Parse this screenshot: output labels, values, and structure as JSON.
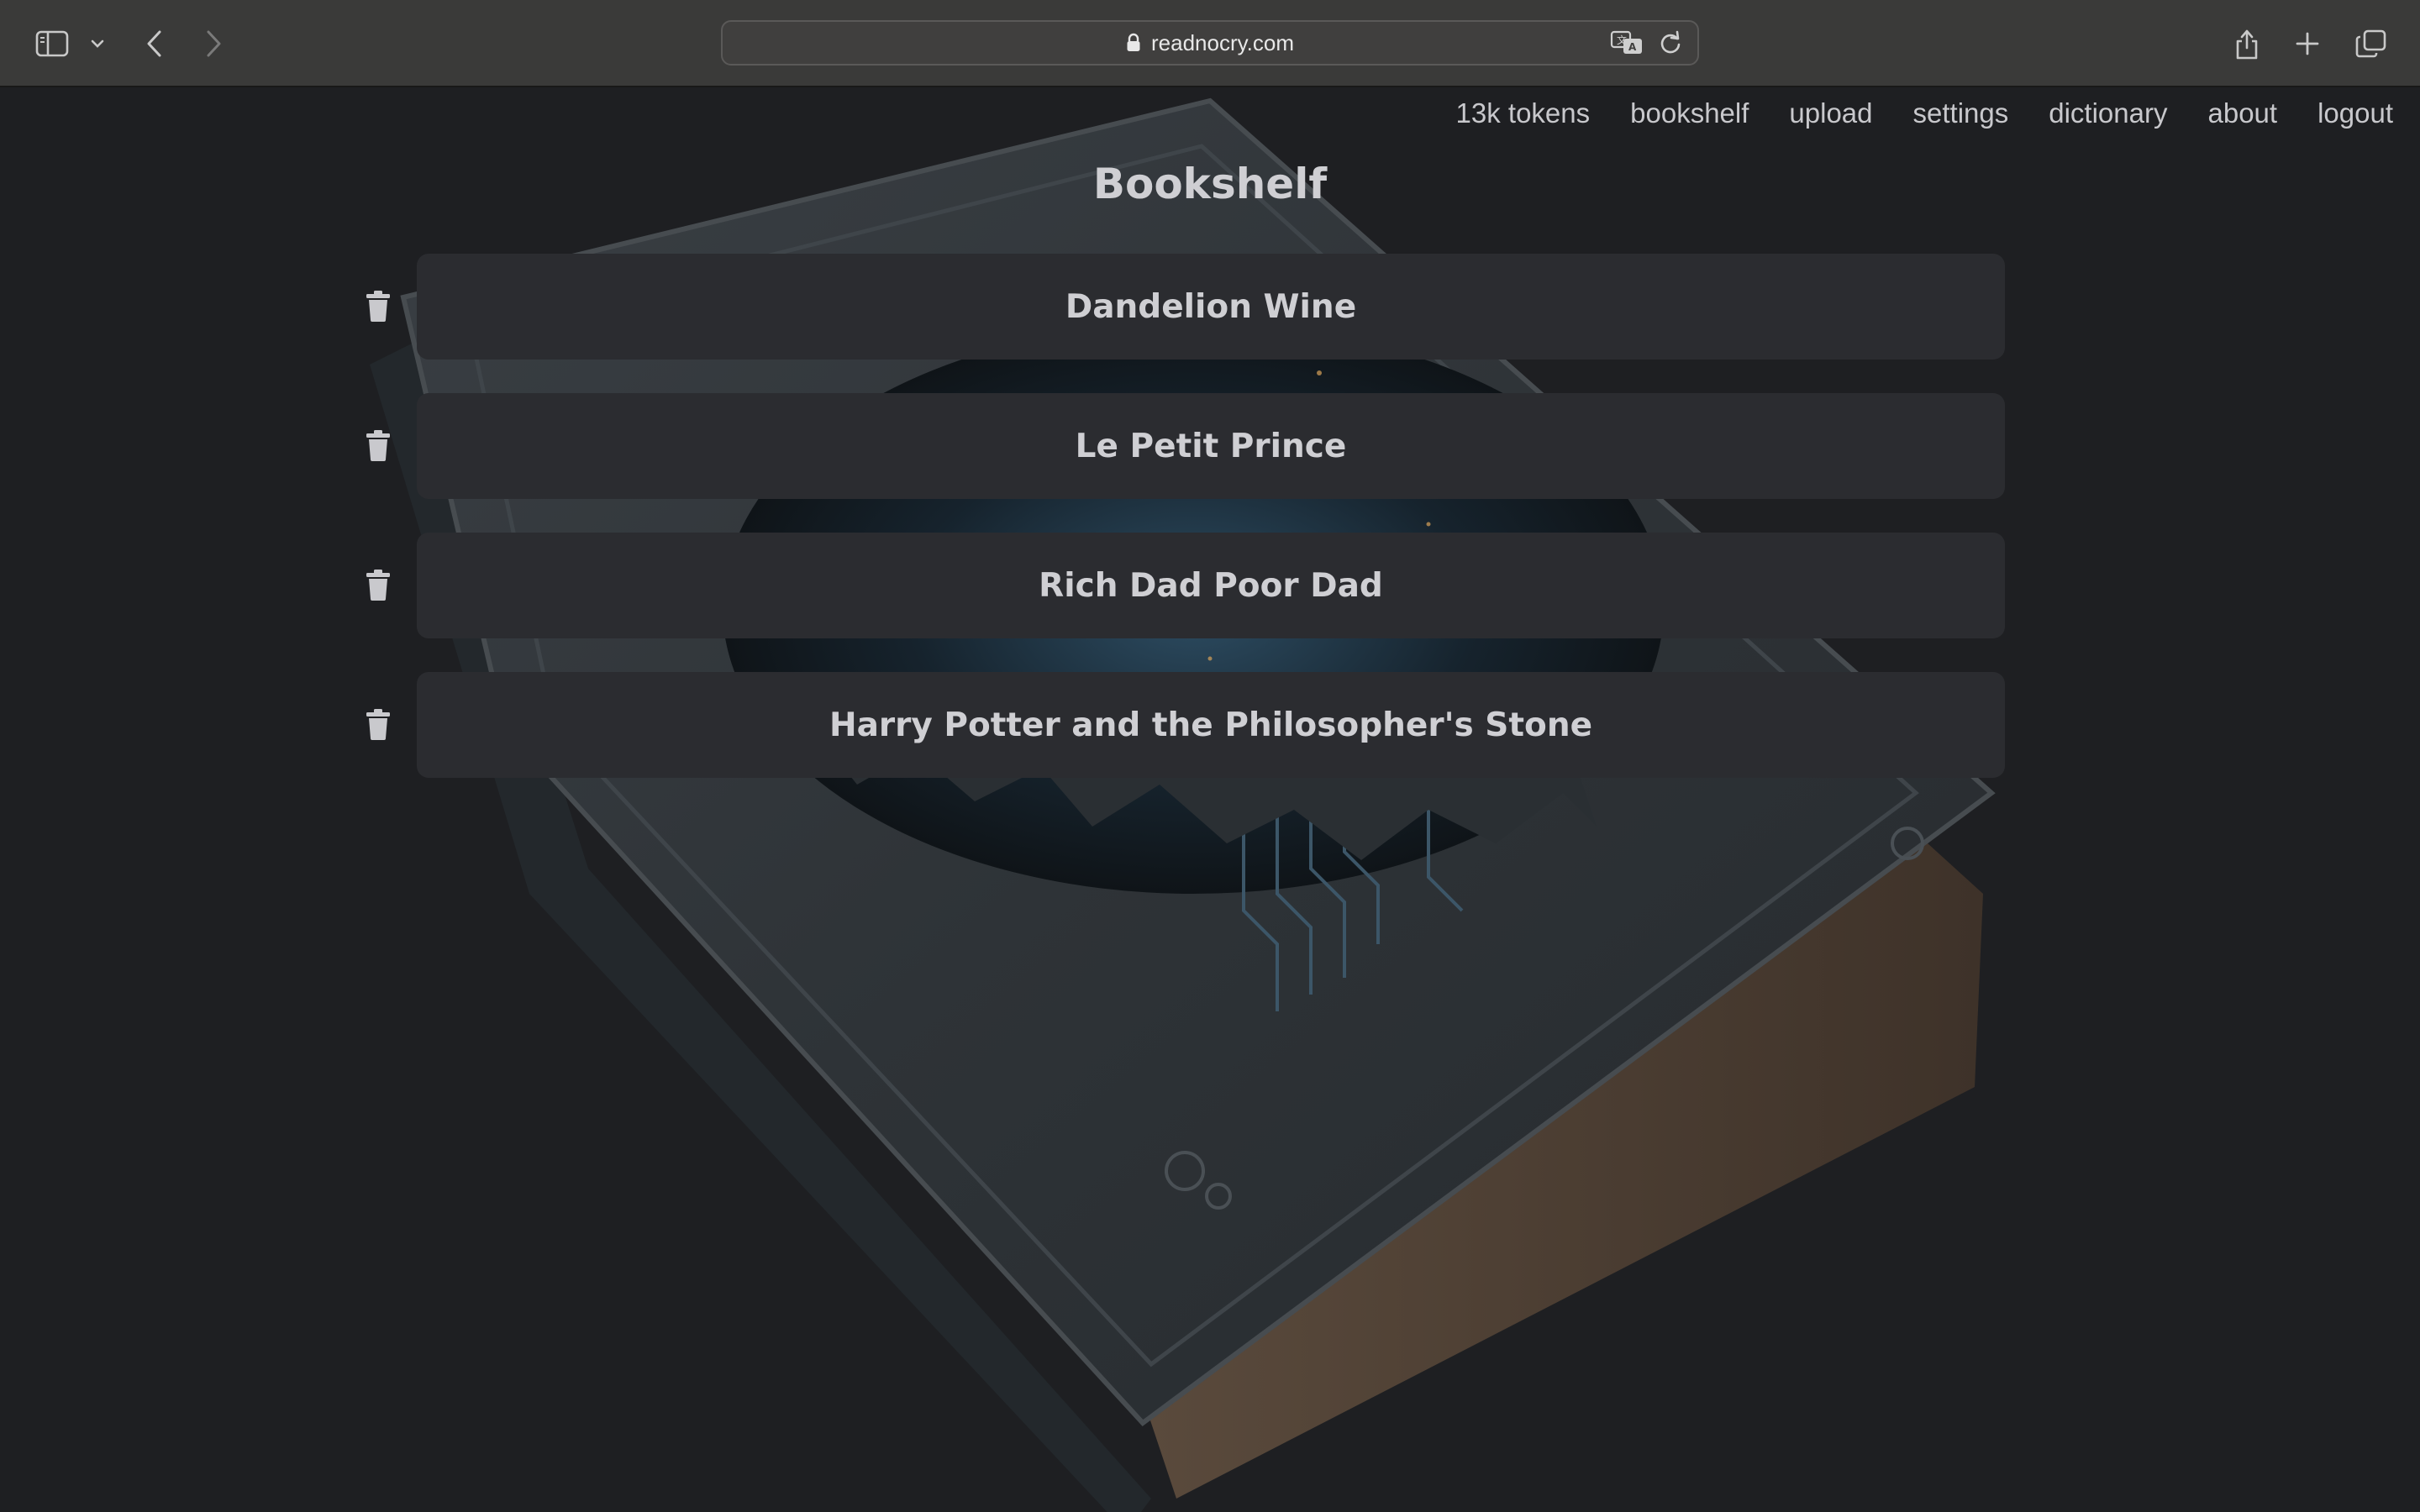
{
  "browser": {
    "url": "readnocry.com",
    "icons": [
      "sidebar-icon",
      "chevron-down-icon",
      "back-arrow-icon",
      "forward-arrow-icon",
      "lock-icon",
      "translate-icon",
      "reload-icon",
      "share-icon",
      "new-tab-plus-icon",
      "tab-overview-icon"
    ]
  },
  "nav": {
    "tokens": "13k tokens",
    "bookshelf": "bookshelf",
    "upload": "upload",
    "settings": "settings",
    "dictionary": "dictionary",
    "about": "about",
    "logout": "logout"
  },
  "page": {
    "title": "Bookshelf"
  },
  "books": [
    "Dandelion Wine",
    "Le Petit Prince",
    "Rich Dad Poor Dad",
    "Harry Potter and the Philosopher's Stone"
  ],
  "colors": {
    "background": "#1e1f22",
    "card": "#2b2c30",
    "text": "#cfcfd3",
    "chrome": "#3a3a39"
  }
}
